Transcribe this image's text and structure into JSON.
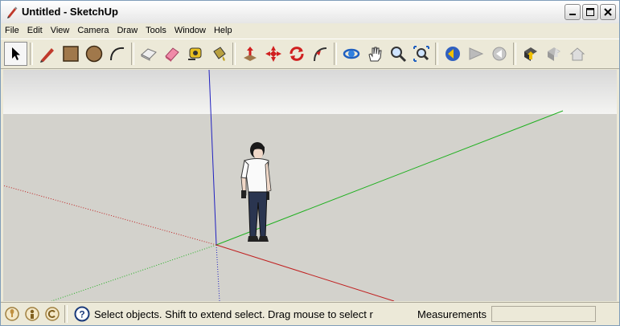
{
  "window": {
    "title": "Untitled - SketchUp"
  },
  "menu": [
    "File",
    "Edit",
    "View",
    "Camera",
    "Draw",
    "Tools",
    "Window",
    "Help"
  ],
  "toolbar": {
    "tools": [
      "select-arrow-icon",
      "pencil-icon",
      "rectangle-icon",
      "circle-icon",
      "arc-icon",
      "eraser-icon",
      "paint-eraser-icon",
      "tape-measure-icon",
      "paint-bucket-icon",
      "push-pull-icon",
      "move-icon",
      "rotate-icon",
      "follow-me-icon",
      "orbit-icon",
      "pan-icon",
      "zoom-icon",
      "zoom-extents-icon",
      "previous-view-icon",
      "next-view-icon",
      "forward-view-icon",
      "components-icon",
      "warehouse-up-icon",
      "warehouse-house-icon"
    ]
  },
  "status": {
    "message": "Select objects. Shift to extend select. Drag mouse to select r",
    "measurements_label": "Measurements",
    "measurements_value": ""
  },
  "colors": {
    "axis_blue": "#2020c0",
    "axis_green": "#20b020",
    "axis_red": "#c02020",
    "sky": "#e8e8e4",
    "ground": "#d3d2cc"
  }
}
